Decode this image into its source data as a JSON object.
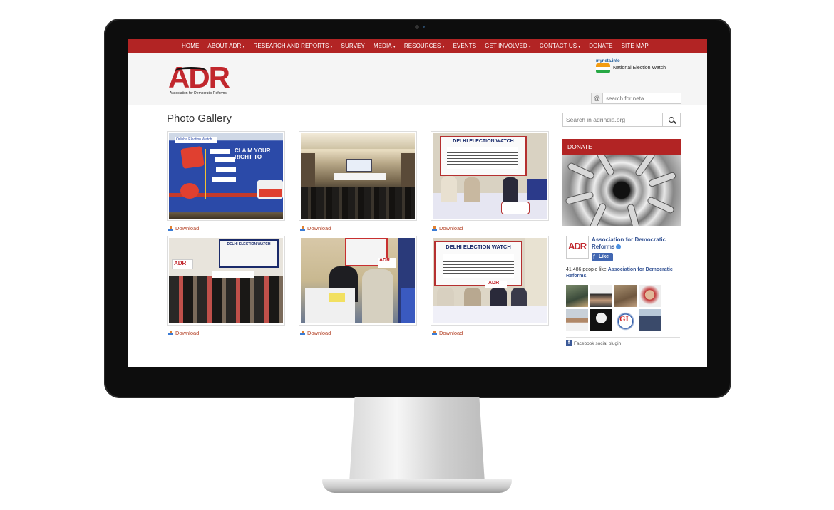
{
  "nav": {
    "items": [
      {
        "label": "HOME",
        "dropdown": false
      },
      {
        "label": "ABOUT ADR",
        "dropdown": true
      },
      {
        "label": "RESEARCH AND REPORTS",
        "dropdown": true
      },
      {
        "label": "SURVEY",
        "dropdown": false
      },
      {
        "label": "MEDIA",
        "dropdown": true
      },
      {
        "label": "RESOURCES",
        "dropdown": true
      },
      {
        "label": "EVENTS",
        "dropdown": false
      },
      {
        "label": "GET INVOLVED",
        "dropdown": true
      },
      {
        "label": "CONTACT US",
        "dropdown": true
      },
      {
        "label": "DONATE",
        "dropdown": false
      },
      {
        "label": "SITE MAP",
        "dropdown": false
      }
    ],
    "bar_color": "#b22424"
  },
  "header": {
    "logo_text": "ADR",
    "logo_subtitle": "Association for Democratic Reforms",
    "new_logo_top": "myneta.info",
    "new_logo_text": "National Election Watch",
    "neta_search_prefix": "@",
    "neta_search_placeholder": "search for neta"
  },
  "main": {
    "title": "Photo Gallery",
    "download_label": "Download",
    "photos": [
      {
        "subject": "Odisha Election Watch banner",
        "caption_text": "CLAIM YOUR RIGHT TO"
      },
      {
        "subject": "conference hall audience",
        "caption_text": ""
      },
      {
        "subject": "Delhi Election Watch press conference",
        "caption_text": "DELHI ELECTION WATCH"
      },
      {
        "subject": "ADR seminar audience",
        "caption_text": "DELHI ELECTION WATCH"
      },
      {
        "subject": "press interview",
        "caption_text": ""
      },
      {
        "subject": "Delhi Election Watch panel",
        "caption_text": "DELHI ELECTION WATCH"
      }
    ]
  },
  "sidebar": {
    "search_placeholder": "Search in adrindia.org",
    "donate_title": "DONATE",
    "facebook": {
      "page_name": "Association for Democratic Reforms",
      "like_label": "Like",
      "count_text": "41,486 people like",
      "count_link": "Association for Democratic Reforms.",
      "plugin_label": "Facebook social plugin"
    }
  },
  "colors": {
    "accent": "#b22424",
    "link": "#3b5998",
    "download": "#b5452a"
  }
}
